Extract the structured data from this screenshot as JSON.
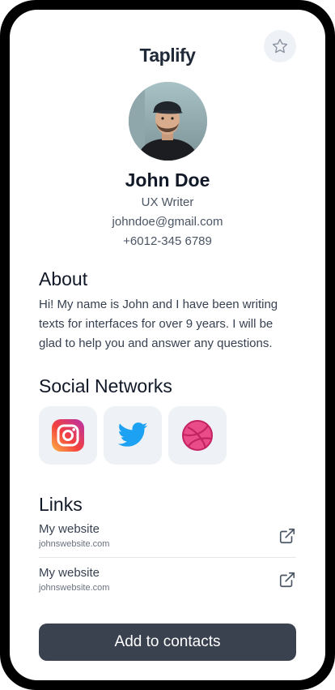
{
  "app": {
    "title": "Taplify"
  },
  "profile": {
    "name": "John Doe",
    "role": "UX Writer",
    "email": "johndoe@gmail.com",
    "phone": "+6012-345 6789"
  },
  "about": {
    "title": "About",
    "text": "Hi! My name is John and I have been writing texts for interfaces for over 9 years. I will be glad to help you and answer any questions."
  },
  "social": {
    "title": "Social Networks",
    "networks": [
      {
        "icon": "instagram-icon"
      },
      {
        "icon": "twitter-icon"
      },
      {
        "icon": "dribbble-icon"
      }
    ]
  },
  "links": {
    "title": "Links",
    "items": [
      {
        "label": "My website",
        "url": "johnswebsite.com"
      },
      {
        "label": "My website",
        "url": "johnswebsite.com"
      }
    ]
  },
  "cta": {
    "label": "Add to contacts"
  },
  "colors": {
    "button_bg": "#3a4250",
    "tile_bg": "#eef1f5",
    "twitter": "#1da1f2",
    "dribbble": "#ea4c89"
  }
}
